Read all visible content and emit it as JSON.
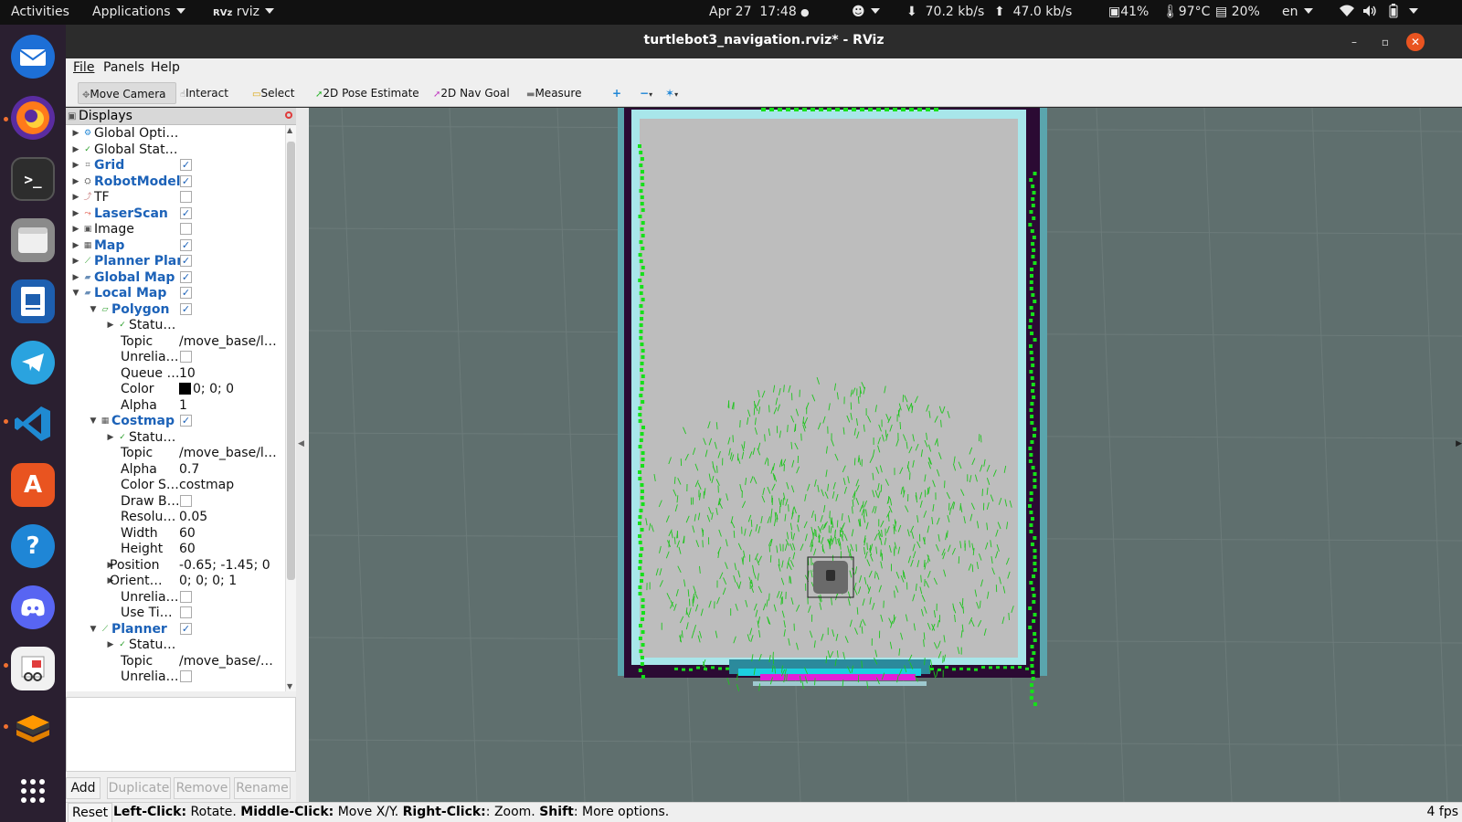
{
  "topbar": {
    "activities": "Activities",
    "applications": "Applications",
    "app_name": "rviz",
    "app_prefix": "RVz",
    "date": "Apr 27",
    "time": "17:48",
    "net_down": "70.2 kb/s",
    "net_up": "47.0 kb/s",
    "cpu": "41%",
    "temp": "97°C",
    "disk": "20%",
    "lang": "en"
  },
  "dock": {
    "apps": [
      "thunderbird-icon",
      "firefox-icon",
      "terminal-icon",
      "files-icon",
      "libreoffice-impress-icon",
      "telegram-icon",
      "vscode-icon",
      "app-center-icon",
      "help-icon",
      "discord-icon",
      "document-viewer-icon",
      "sublime-icon",
      "show-apps-icon"
    ],
    "terminal_glyph": ">_",
    "help_glyph": "?",
    "appstore_glyph": "A"
  },
  "window": {
    "title": "turtlebot3_navigation.rviz* - RViz",
    "minimize": "–",
    "maximize": "▫",
    "close": "✕"
  },
  "menu": {
    "file": "File",
    "panels": "Panels",
    "help": "Help"
  },
  "toolbar": {
    "move_camera": "Move Camera",
    "interact": "Interact",
    "select": "Select",
    "pose_estimate": "2D Pose Estimate",
    "nav_goal": "2D Nav Goal",
    "measure": "Measure",
    "plus": "+",
    "minus": "−",
    "star": "✶"
  },
  "displays": {
    "header": "Displays",
    "rows": [
      {
        "name": "Global Opti…",
        "value": "",
        "indent": 0,
        "expander": "closed",
        "icon": "gear",
        "bold": false,
        "check": null
      },
      {
        "name": "Global Stat…",
        "value": "",
        "indent": 0,
        "expander": "closed",
        "icon": "check",
        "bold": false,
        "check": null
      },
      {
        "name": "Grid",
        "value": "",
        "indent": 0,
        "expander": "closed",
        "icon": "grid",
        "bold": true,
        "check": true
      },
      {
        "name": "RobotModel",
        "value": "",
        "indent": 0,
        "expander": "closed",
        "icon": "robot",
        "bold": true,
        "check": true
      },
      {
        "name": "TF",
        "value": "",
        "indent": 0,
        "expander": "closed",
        "icon": "tf",
        "bold": false,
        "check": false
      },
      {
        "name": "LaserScan",
        "value": "",
        "indent": 0,
        "expander": "closed",
        "icon": "laser",
        "bold": true,
        "check": true
      },
      {
        "name": "Image",
        "value": "",
        "indent": 0,
        "expander": "closed",
        "icon": "image",
        "bold": false,
        "check": false
      },
      {
        "name": "Map",
        "value": "",
        "indent": 0,
        "expander": "closed",
        "icon": "map",
        "bold": true,
        "check": true
      },
      {
        "name": "Planner Plan",
        "value": "",
        "indent": 0,
        "expander": "closed",
        "icon": "path",
        "bold": true,
        "check": true
      },
      {
        "name": "Global Map",
        "value": "",
        "indent": 0,
        "expander": "closed",
        "icon": "folder",
        "bold": true,
        "check": true
      },
      {
        "name": "Local Map",
        "value": "",
        "indent": 0,
        "expander": "open",
        "icon": "folder",
        "bold": true,
        "check": true
      },
      {
        "name": "Polygon",
        "value": "",
        "indent": 1,
        "expander": "open",
        "icon": "polygon",
        "bold": true,
        "check": true
      },
      {
        "name": "Statu…",
        "value": "",
        "indent": 2,
        "expander": "closed",
        "icon": "check",
        "bold": false,
        "check": null
      },
      {
        "name": "Topic",
        "value": "/move_base/l…",
        "indent": 3,
        "expander": "none",
        "icon": "none",
        "bold": false,
        "check": null
      },
      {
        "name": "Unrelia…",
        "value": "",
        "indent": 3,
        "expander": "none",
        "icon": "none",
        "bold": false,
        "check": false
      },
      {
        "name": "Queue …",
        "value": "10",
        "indent": 3,
        "expander": "none",
        "icon": "none",
        "bold": false,
        "check": null
      },
      {
        "name": "Color",
        "value": "0; 0; 0",
        "indent": 3,
        "expander": "none",
        "icon": "none",
        "bold": false,
        "check": null,
        "swatch": "#000000"
      },
      {
        "name": "Alpha",
        "value": "1",
        "indent": 3,
        "expander": "none",
        "icon": "none",
        "bold": false,
        "check": null
      },
      {
        "name": "Costmap",
        "value": "",
        "indent": 1,
        "expander": "open",
        "icon": "map",
        "bold": true,
        "check": true
      },
      {
        "name": "Statu…",
        "value": "",
        "indent": 2,
        "expander": "closed",
        "icon": "check",
        "bold": false,
        "check": null
      },
      {
        "name": "Topic",
        "value": "/move_base/l…",
        "indent": 3,
        "expander": "none",
        "icon": "none",
        "bold": false,
        "check": null
      },
      {
        "name": "Alpha",
        "value": "0.7",
        "indent": 3,
        "expander": "none",
        "icon": "none",
        "bold": false,
        "check": null
      },
      {
        "name": "Color S…",
        "value": "costmap",
        "indent": 3,
        "expander": "none",
        "icon": "none",
        "bold": false,
        "check": null
      },
      {
        "name": "Draw B…",
        "value": "",
        "indent": 3,
        "expander": "none",
        "icon": "none",
        "bold": false,
        "check": false
      },
      {
        "name": "Resolu…",
        "value": "0.05",
        "indent": 3,
        "expander": "none",
        "icon": "none",
        "bold": false,
        "check": null
      },
      {
        "name": "Width",
        "value": "60",
        "indent": 3,
        "expander": "none",
        "icon": "none",
        "bold": false,
        "check": null
      },
      {
        "name": "Height",
        "value": "60",
        "indent": 3,
        "expander": "none",
        "icon": "none",
        "bold": false,
        "check": null
      },
      {
        "name": "Position",
        "value": "-0.65; -1.45; 0",
        "indent": 2,
        "expander": "closed",
        "icon": "none",
        "bold": false,
        "check": null
      },
      {
        "name": "Orient…",
        "value": "0; 0; 0; 1",
        "indent": 2,
        "expander": "closed",
        "icon": "none",
        "bold": false,
        "check": null
      },
      {
        "name": "Unrelia…",
        "value": "",
        "indent": 3,
        "expander": "none",
        "icon": "none",
        "bold": false,
        "check": false
      },
      {
        "name": "Use Ti…",
        "value": "",
        "indent": 3,
        "expander": "none",
        "icon": "none",
        "bold": false,
        "check": false
      },
      {
        "name": "Planner",
        "value": "",
        "indent": 1,
        "expander": "open",
        "icon": "path",
        "bold": true,
        "check": true
      },
      {
        "name": "Statu…",
        "value": "",
        "indent": 2,
        "expander": "closed",
        "icon": "check",
        "bold": false,
        "check": null
      },
      {
        "name": "Topic",
        "value": "/move_base/…",
        "indent": 3,
        "expander": "none",
        "icon": "none",
        "bold": false,
        "check": null
      },
      {
        "name": "Unrelia…",
        "value": "",
        "indent": 3,
        "expander": "none",
        "icon": "none",
        "bold": false,
        "check": false
      }
    ],
    "buttons": {
      "add": "Add",
      "duplicate": "Duplicate",
      "remove": "Remove",
      "rename": "Rename"
    }
  },
  "statusbar": {
    "reset": "Reset",
    "left_click_label": "Left-Click:",
    "left_click_text": " Rotate. ",
    "middle_click_label": "Middle-Click:",
    "middle_click_text": " Move X/Y. ",
    "right_click_label": "Right-Click:",
    "right_click_text": ": Zoom. ",
    "shift_label": "Shift",
    "shift_text": ": More options.",
    "fps": "4 fps"
  },
  "colors": {
    "map_background": "#5f6f6e",
    "room_floor": "#bdbdbd",
    "costmap_inflation": "#a8e6ea",
    "lethal_wall": "#2b0a33",
    "laser_points": "#16e01a",
    "particles": "#1fc41f",
    "inflation_magenta": "#e01fd8",
    "inflation_cyan": "#1ccfe0",
    "accent_blue": "#1c62b8"
  }
}
